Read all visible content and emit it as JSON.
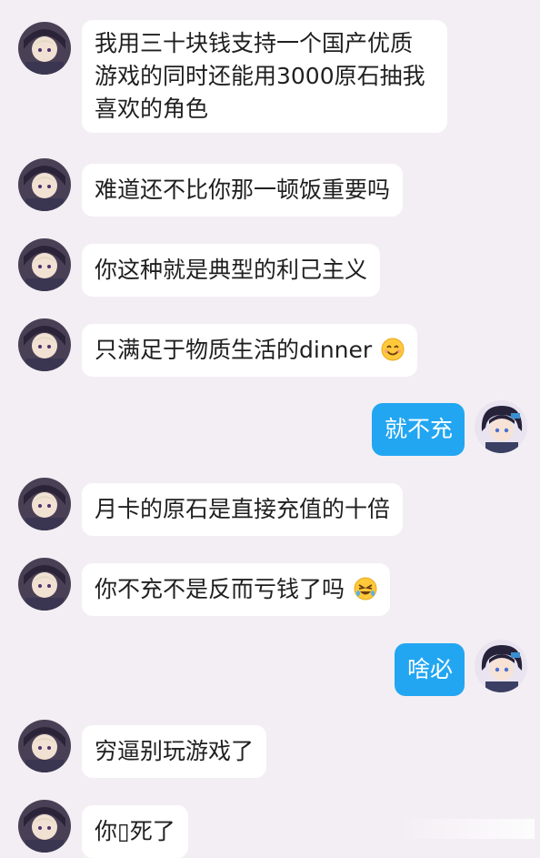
{
  "messages": [
    {
      "side": "left",
      "text": "我用三十块钱支持一个国产优质游戏的同时还能用3000原石抽我喜欢的角色"
    },
    {
      "side": "left",
      "text": "难道还不比你那一顿饭重要吗"
    },
    {
      "side": "left",
      "text": "你这种就是典型的利己主义"
    },
    {
      "side": "left",
      "text": "只满足于物质生活的dinner",
      "emoji": "smiling-face-icon"
    },
    {
      "side": "right",
      "text": "就不充"
    },
    {
      "side": "left",
      "text": "月卡的原石是直接充值的十倍"
    },
    {
      "side": "left",
      "text": "你不充不是反而亏钱了吗",
      "emoji": "rolling-laughing-face-icon"
    },
    {
      "side": "right",
      "text": "啥必"
    },
    {
      "side": "left",
      "text": "穷逼别玩游戏了"
    },
    {
      "side": "left",
      "text": "你▯死了"
    }
  ],
  "colors": {
    "background": "#f3eef3",
    "incoming_bubble": "#ffffff",
    "outgoing_bubble": "#22a6f2",
    "text": "#1f1f1f"
  }
}
